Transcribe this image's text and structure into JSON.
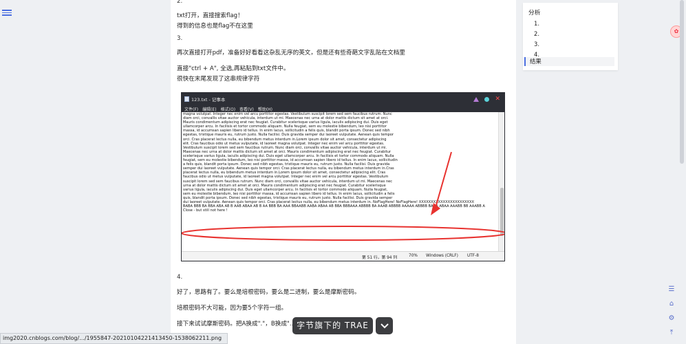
{
  "article": {
    "line_top_num": "2.",
    "p1": "txt打开，直接搜索flag！",
    "p2": "得到的信息也是flag不在这里",
    "num3": "3.",
    "p3": "再次直接打开pdf，准备好好看看这杂乱无序的英文，但是还有些奇葩文字乱贴在文档里",
    "p4": "直接\"ctrl + A\", 全选,再粘贴到txt文件中。",
    "p5": "很快在末尾发现了这串规律字符",
    "num4": "4.",
    "p6": "好了，思路有了。要么是培根密码，要么是二进制，要么是摩斯密码。",
    "p7": "培根密码不大可能，因为要5个字符一组。",
    "p8": "接下来试试摩斯密码。把A换成\".\"，B换成\"..."
  },
  "notepad": {
    "title": "123.txt - 记事本",
    "menu": [
      "文件(F)",
      "编辑(E)",
      "格式(O)",
      "查看(V)",
      "帮助(H)"
    ],
    "lines": [
      "magna volutpat. Integer nec enim vel arcu porttitor egestas. Vestibulum suscipit lorem sed sem faucibus rutrum. Nunc",
      "diam orci, convallis vitae auctor vehicula, interdum ut mi. Maecenas nec urna at dolor mattis dictum sit amet at orci.",
      "Mauris condimentum adipiscing erat nec feugiat. Curabitur scelerisque varius ligula, iaculis adipiscing dui. Duis eget",
      "ullamcorper arcu. In facilisis et tortor commodo aliquam. Nulla feugiat, sem eu molestie bibendum, leo nisi porttitor",
      "massa, id accumsan sapien libero id tellus. In enim lacus, sollicitudin a felis quis, blandit porta ipsum. Donec sed nibh",
      "egestas, tristique mauris eu, rutrum justo. Nulla facilisi. Duis gravida semper dui laoreet vulputate. Aenean quis tempor",
      "orci. Cras placerat lectus nulla, eu bibendum metus interdum in.Lorem ipsum dolor sit amet, consectetur adipiscing",
      "elit. Cras faucibus odio ut metus vulputate, id laoreet magna volutpat. Integer nec enim vel arcu porttitor egestas.",
      "Vestibulum suscipit lorem sed sem faucibus rutrum. Nunc diam orci, convallis vitae auctor vehicula, interdum ut mi.",
      "Maecenas nec urna at dolor mattis dictum sit amet at orci. Mauris condimentum adipiscing erat nec feugiat. Curabitur",
      "scelerisque varius ligula, iaculis adipiscing dui. Duis eget ullamcorper arcu. In facilisis et tortor commodo aliquam. Nulla",
      "feugiat, sem eu molestie bibendum, leo nisi porttitor massa, id accumsan sapien libero id tellus. In enim lacus, sollicitudin",
      "a felis quis, blandit porta ipsum. Donec sed nibh egestas, tristique mauris eu, rutrum justo. Nulla facilisi. Duis gravida",
      "semper dui laoreet vulputate. Aenean quis tempor orci. Cras placerat lectus nulla, eu bibendum metus interdum in.Cras",
      "placerat lectus nulla, eu bibendum metus interdum in.Lorem ipsum dolor sit amet, consectetur adipiscing elit. Cras",
      "faucibus odio ut metus vulputate, id laoreet magna volutpat. Integer nec enim vel arcu porttitor egestas. Vestibulum",
      "suscipit lorem sed sem faucibus rutrum. Nunc diam orci, convallis vitae auctor vehicula, interdum ut mi. Maecenas nec",
      "urna at dolor mattis dictum sit amet at orci. Mauris condimentum adipiscing erat nec feugiat. Curabitur scelerisque",
      "varius ligula, iaculis adipiscing dui. Duis eget ullamcorper arcu. In facilisis et tortor commodo aliquam. Nulla feugiat,",
      "sem eu molestie bibendum, leo nisi porttitor massa, id accumsan sapien libero id tellus. In enim lacus, sollicitudin a felis",
      "quis, blandit porta ipsum. Donec sed nibh egestas, tristique mauris eu, rutrum justo. Nulla facilisi. Duis gravida semper",
      "dui laoreet vulputate. Aenean quis tempor orci. Cras placerat lectus nulla, eu bibendum metus interdum in. NoFlagHere! NoFlagHere! XXXXXXXXXXXXXXXXXXXXXXX",
      "BABA BBB BA BBA ABA AB B AAB ABAA AB B AA BBB BA AAA BBAABB AABA ABAA AB BBA BBBAAA ABBBB BA AAAB ABBBB AAAAA ABBBB BAAA ABAA AAABB BB AAABB A",
      "Close - but still not here !"
    ],
    "status": {
      "position": "第 51 行，第 94 列",
      "zoom": "70%",
      "line_ending": "Windows (CRLF)",
      "encoding": "UTF-8"
    }
  },
  "toc": {
    "title": "分析",
    "items": [
      "1.",
      "2.",
      "3.",
      "4."
    ],
    "active": "结果"
  },
  "side_tools": {
    "icons": [
      "list-icon",
      "home-icon",
      "settings-icon",
      "top-icon"
    ]
  },
  "url_bar": "img2020.cnblogs.com/blog/.../1955847-20210104221413450-1538062211.png",
  "watermark": "字节旗下的 TRAE",
  "colors": {
    "accent": "#4a6ee0",
    "annotation_red": "#e8322f"
  }
}
